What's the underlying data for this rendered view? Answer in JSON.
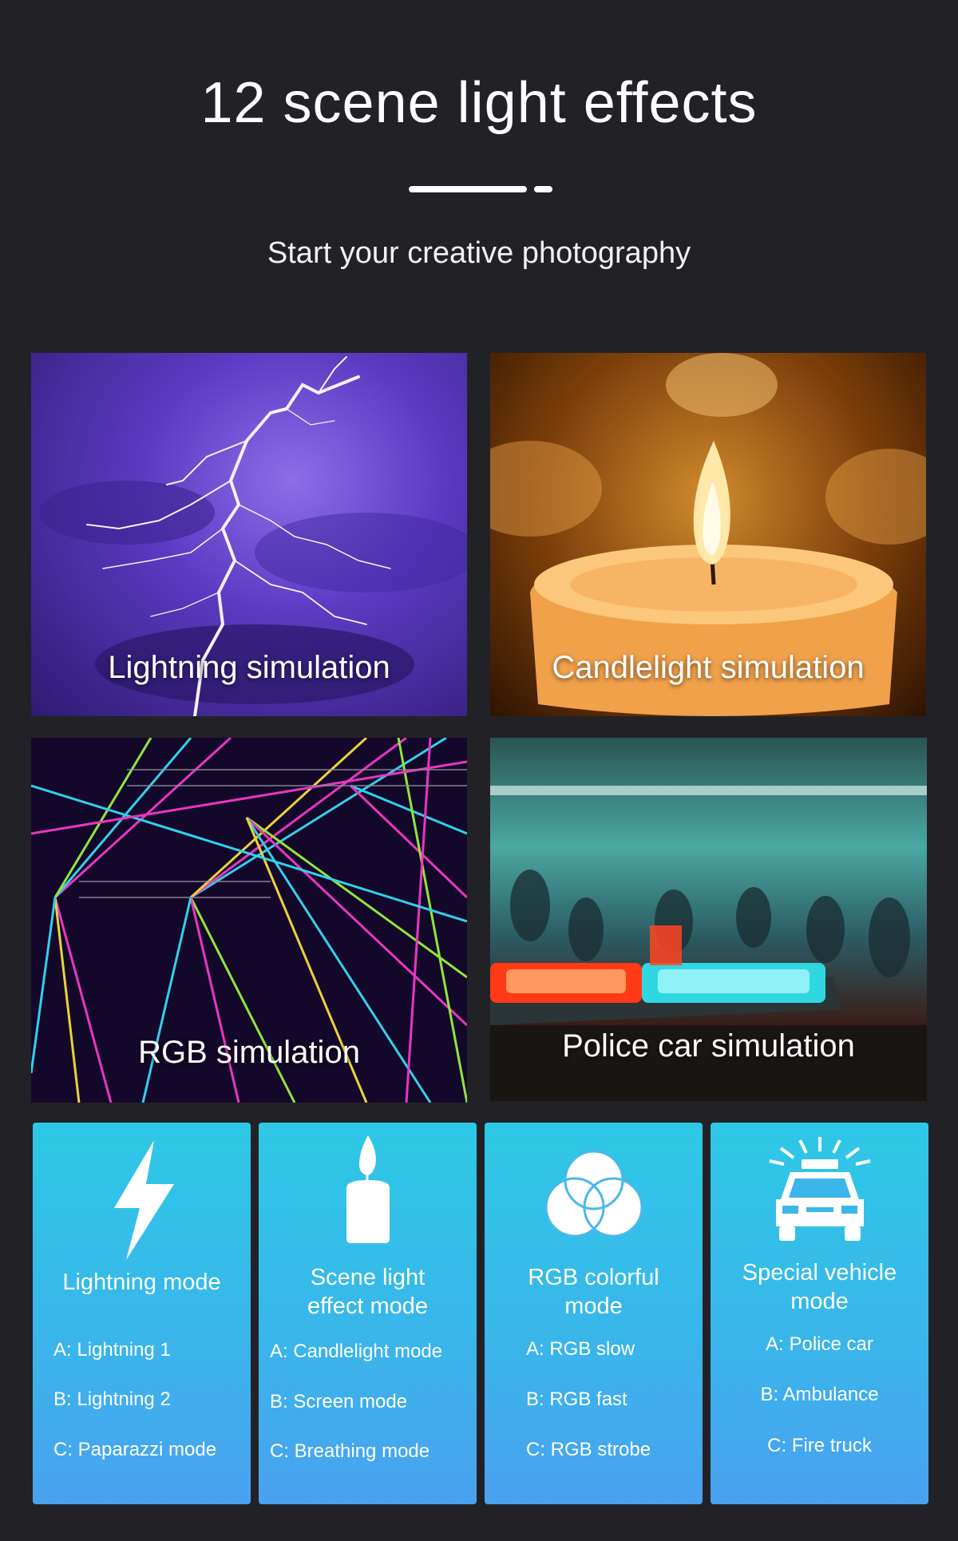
{
  "header": {
    "title": "12 scene light effects",
    "subtitle": "Start your creative photography"
  },
  "tiles": [
    {
      "caption": "Lightning simulation"
    },
    {
      "caption": "Candlelight simulation"
    },
    {
      "caption": "RGB simulation"
    },
    {
      "caption": "Police car simulation"
    }
  ],
  "modes": [
    {
      "icon": "lightning-icon",
      "title_line1": "Lightning mode",
      "title_line2": "",
      "options": [
        "A: Lightning 1",
        "B: Lightning 2",
        "C: Paparazzi mode"
      ]
    },
    {
      "icon": "candle-icon",
      "title_line1": "Scene light",
      "title_line2": "effect mode",
      "options": [
        "A: Candlelight mode",
        "B: Screen mode",
        "C: Breathing mode"
      ]
    },
    {
      "icon": "rgb-circles-icon",
      "title_line1": "RGB colorful",
      "title_line2": "mode",
      "options": [
        "A: RGB slow",
        "B: RGB fast",
        "C: RGB strobe"
      ]
    },
    {
      "icon": "police-car-icon",
      "title_line1": "Special vehicle",
      "title_line2": "mode",
      "options": [
        "A: Police car",
        "B: Ambulance",
        "C: Fire truck"
      ]
    }
  ],
  "colors": {
    "background": "#222226",
    "card_gradient_top": "#2ec8e6",
    "card_gradient_bottom": "#4aa1f0"
  }
}
